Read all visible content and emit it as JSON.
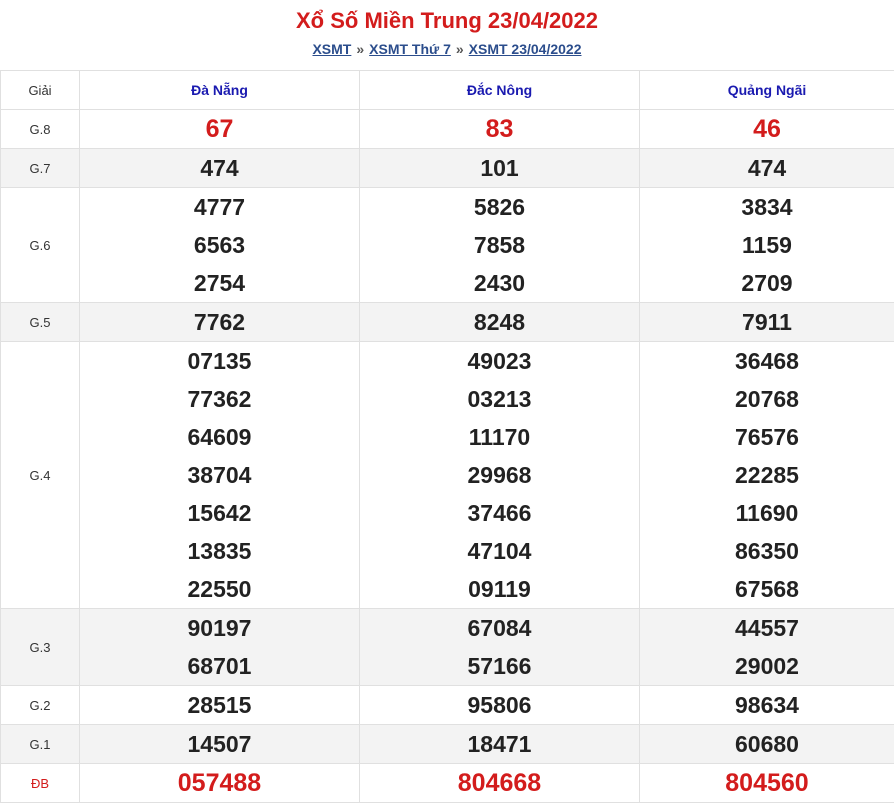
{
  "header": {
    "title": "Xổ Số Miền Trung 23/04/2022",
    "breadcrumb": [
      "XSMT",
      "XSMT Thứ 7",
      "XSMT 23/04/2022"
    ],
    "separator": "»"
  },
  "table": {
    "label_header": "Giải",
    "provinces": [
      "Đà Nẵng",
      "Đắc Nông",
      "Quảng Ngãi"
    ],
    "prizes": [
      {
        "label": "G.8",
        "values": [
          [
            "67"
          ],
          [
            "83"
          ],
          [
            "46"
          ]
        ]
      },
      {
        "label": "G.7",
        "values": [
          [
            "474"
          ],
          [
            "101"
          ],
          [
            "474"
          ]
        ]
      },
      {
        "label": "G.6",
        "values": [
          [
            "4777",
            "6563",
            "2754"
          ],
          [
            "5826",
            "7858",
            "2430"
          ],
          [
            "3834",
            "1159",
            "2709"
          ]
        ]
      },
      {
        "label": "G.5",
        "values": [
          [
            "7762"
          ],
          [
            "8248"
          ],
          [
            "7911"
          ]
        ]
      },
      {
        "label": "G.4",
        "values": [
          [
            "07135",
            "77362",
            "64609",
            "38704",
            "15642",
            "13835",
            "22550"
          ],
          [
            "49023",
            "03213",
            "11170",
            "29968",
            "37466",
            "47104",
            "09119"
          ],
          [
            "36468",
            "20768",
            "76576",
            "22285",
            "11690",
            "86350",
            "67568"
          ]
        ]
      },
      {
        "label": "G.3",
        "values": [
          [
            "90197",
            "68701"
          ],
          [
            "67084",
            "57166"
          ],
          [
            "44557",
            "29002"
          ]
        ]
      },
      {
        "label": "G.2",
        "values": [
          [
            "28515"
          ],
          [
            "95806"
          ],
          [
            "98634"
          ]
        ]
      },
      {
        "label": "G.1",
        "values": [
          [
            "14507"
          ],
          [
            "18471"
          ],
          [
            "60680"
          ]
        ]
      },
      {
        "label": "ĐB",
        "values": [
          [
            "057488"
          ],
          [
            "804668"
          ],
          [
            "804560"
          ]
        ]
      }
    ]
  },
  "colors": {
    "title": "#d31c1c",
    "province": "#1a1ab0",
    "link": "#2b4d8c",
    "alt_row": "#f3f3f3"
  }
}
